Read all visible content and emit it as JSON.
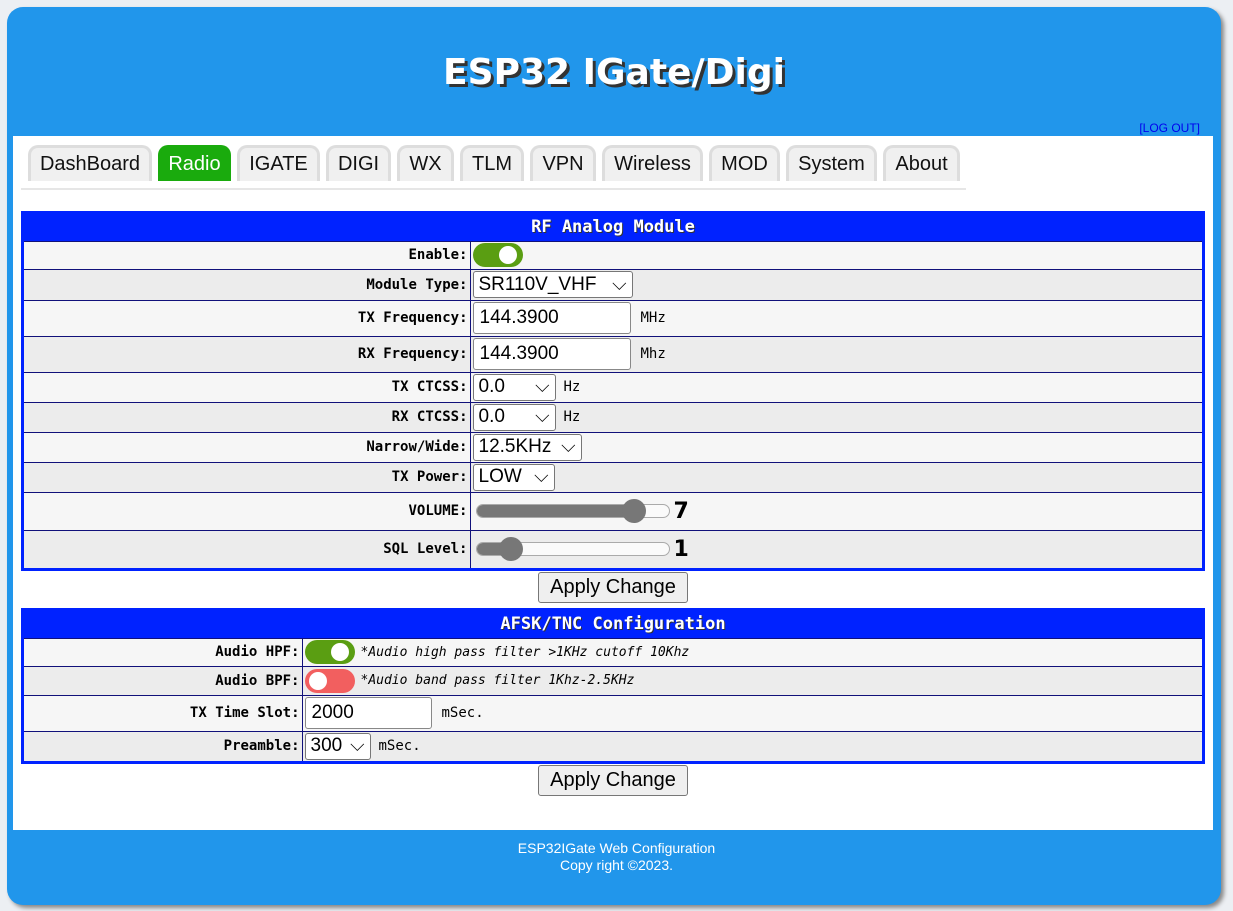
{
  "header": {
    "title": "ESP32 IGate/Digi",
    "logout": "[LOG OUT]"
  },
  "tabs": [
    "DashBoard",
    "Radio",
    "IGATE",
    "DIGI",
    "WX",
    "TLM",
    "VPN",
    "Wireless",
    "MOD",
    "System",
    "About"
  ],
  "active_tab": "Radio",
  "rf": {
    "title": "RF Analog Module",
    "enable_label": "Enable:",
    "enable": true,
    "module_label": "Module Type:",
    "module": "SR110V_VHF",
    "txf_label": "TX Frequency:",
    "txf": "144.3900",
    "txf_unit": "MHz",
    "rxf_label": "RX Frequency:",
    "rxf": "144.3900",
    "rxf_unit": "Mhz",
    "txc_label": "TX CTCSS:",
    "txc": "0.0",
    "txc_unit": "Hz",
    "rxc_label": "RX CTCSS:",
    "rxc": "0.0",
    "rxc_unit": "Hz",
    "nw_label": "Narrow/Wide:",
    "nw": "12.5KHz",
    "pwr_label": "TX Power:",
    "pwr": "LOW",
    "vol_label": "VOLUME:",
    "vol": "7",
    "sql_label": "SQL Level:",
    "sql": "1",
    "apply": "Apply Change"
  },
  "afsk": {
    "title": "AFSK/TNC Configuration",
    "hpf_label": "Audio HPF:",
    "hpf": true,
    "hpf_note": "*Audio high pass filter >1KHz cutoff 10Khz",
    "bpf_label": "Audio BPF:",
    "bpf": false,
    "bpf_note": "*Audio band pass filter 1Khz-2.5KHz",
    "slot_label": "TX Time Slot:",
    "slot": "2000",
    "slot_unit": "mSec.",
    "pre_label": "Preamble:",
    "pre": "300",
    "pre_unit": "mSec.",
    "apply": "Apply Change"
  },
  "footer": {
    "line1": "ESP32IGate Web Configuration",
    "line2": "Copy right ©2023."
  },
  "colors": {
    "header": "#2196eb",
    "active_tab": "#1aab0d",
    "table_border": "#0022ff",
    "toggle_on": "#5a9e12",
    "toggle_off": "#f25f5f"
  }
}
